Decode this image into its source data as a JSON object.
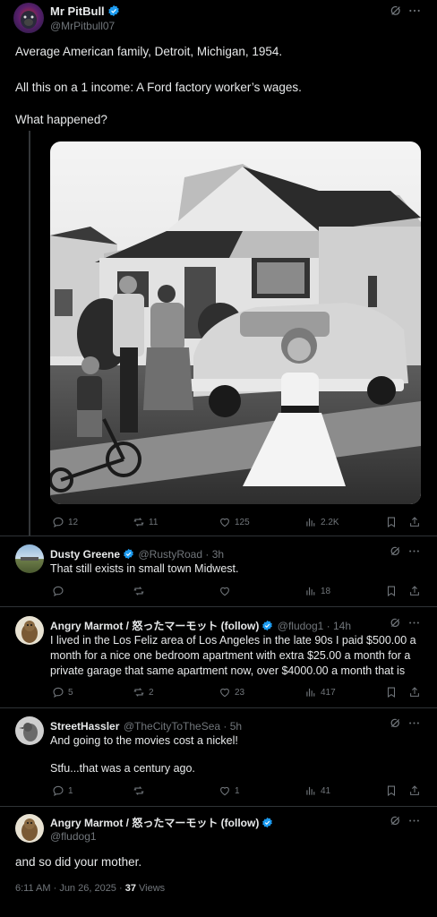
{
  "main_tweet": {
    "name": "Mr PitBull",
    "handle": "@MrPitbull07",
    "line1": "Average American family, Detroit, Michigan, 1954.",
    "line2": "All this on a 1 income: A Ford factory worker’s wages.",
    "line3": "What happened?",
    "stats": {
      "replies": "12",
      "reposts": "11",
      "likes": "125",
      "views": "2.2K"
    }
  },
  "replies": [
    {
      "name": "Dusty Greene",
      "handle": "@RustyRoad · 3h",
      "text": "That still exists in small town Midwest.",
      "stats": {
        "replies": "",
        "reposts": "",
        "likes": "",
        "views": "18"
      }
    },
    {
      "name": "Angry Marmot / 怒ったマーモット (follow)",
      "handle": "@fludog1 · 14h",
      "text": "I lived in the Los Feliz area of Los Angeles in the late 90s I paid $500.00 a month for a nice one bedroom apartment with extra $25.00 a month for a private garage that same apartment now, over $4000.00 a month that is",
      "stats": {
        "replies": "5",
        "reposts": "2",
        "likes": "23",
        "views": "417"
      }
    },
    {
      "name": "StreetHassler",
      "handle": "@TheCityToTheSea · 5h",
      "line1": "And going to the movies cost a nickel!",
      "line2": "Stfu...that was a century ago.",
      "stats": {
        "replies": "1",
        "reposts": "",
        "likes": "1",
        "views": "41"
      }
    }
  ],
  "final_tweet": {
    "name": "Angry Marmot / 怒ったマーモット (follow)",
    "handle": "@fludog1",
    "text": "and so did your mother.",
    "time": "6:11 AM · Jun 26, 2025 · ",
    "views_count": "37",
    "views_label": " Views"
  },
  "colors": {
    "background": "#000000",
    "verified": "#1d9bf0",
    "muted": "#71767b",
    "text": "#e7e9ea"
  },
  "icons": [
    "reply-icon",
    "repost-icon",
    "like-icon",
    "views-icon",
    "bookmark-icon",
    "share-icon",
    "grok-icon",
    "more-icon",
    "verified-badge-icon"
  ]
}
